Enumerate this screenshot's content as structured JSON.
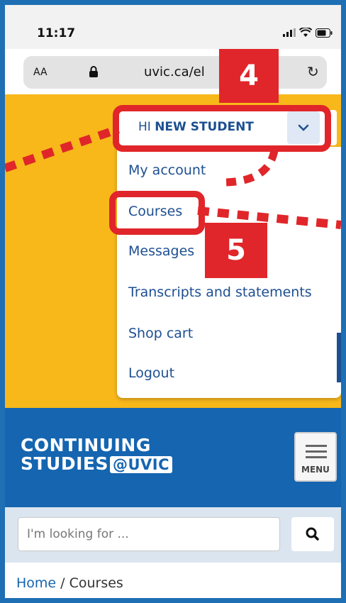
{
  "status": {
    "time": "11:17"
  },
  "browser": {
    "aa": "AA",
    "url": "uvic.ca/el",
    "reload_glyph": "↻"
  },
  "account": {
    "greeting_prefix": "HI ",
    "greeting_name": "NEW STUDENT",
    "chevron_glyph": "⌄"
  },
  "dropdown": {
    "items": [
      "My account",
      "Courses",
      "Messages",
      "Transcripts and statements",
      "Shop cart",
      "Logout"
    ]
  },
  "logo": {
    "line1": "CONTINUING",
    "line2": "STUDIES",
    "at": "@",
    "brand": "UVIC"
  },
  "nav": {
    "menu_label": "MENU"
  },
  "search": {
    "placeholder": "I'm looking for ...",
    "icon_glyph": "🔍"
  },
  "breadcrumb": {
    "home": "Home",
    "sep": " / ",
    "current": "Courses"
  },
  "annotations": {
    "step4": "4",
    "step5": "5"
  },
  "colors": {
    "brand_blue": "#1565b0",
    "hero_yellow": "#f8b81a",
    "annotation_red": "#e0262a"
  }
}
